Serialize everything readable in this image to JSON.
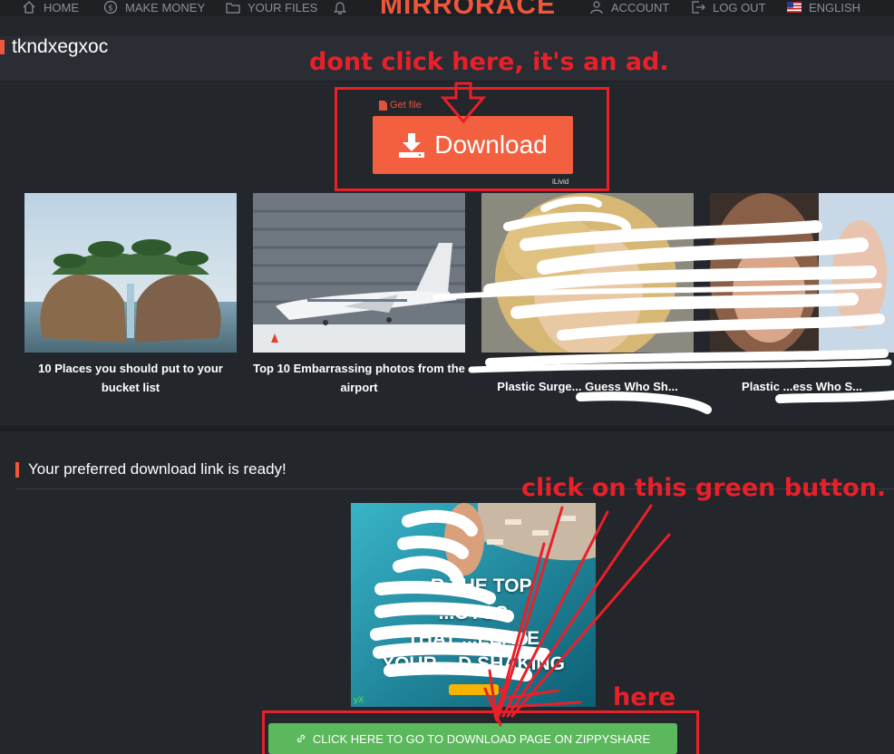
{
  "nav": {
    "items": [
      {
        "label": "HOME",
        "icon": "home-icon"
      },
      {
        "label": "MAKE MONEY",
        "icon": "dollar-icon"
      },
      {
        "label": "YOUR FILES",
        "icon": "folder-icon"
      },
      {
        "label": "",
        "icon": "bell-icon"
      },
      {
        "label": "ACCOUNT",
        "icon": "user-icon"
      },
      {
        "label": "LOG OUT",
        "icon": "logout-icon"
      },
      {
        "label": "ENGLISH",
        "icon": "us-flag-icon"
      }
    ],
    "logo": "MIRRORACE"
  },
  "file": {
    "title": "tkndxegxoc"
  },
  "ad": {
    "get_file": "Get file",
    "download_label": "Download",
    "sponsor": "iLivid"
  },
  "thumbnails": [
    {
      "caption": "10 Places you should put to your bucket list"
    },
    {
      "caption": "Top 10 Embarrassing photos from the airport"
    },
    {
      "caption": "Plastic Surge... Guess Who Sh..."
    },
    {
      "caption": "Plastic ...ess Who S..."
    }
  ],
  "download": {
    "ready_text": "Your preferred download link is ready!",
    "promo_lines": [
      "...R THE TOP",
      "...OTOS",
      "THAT ...LEAVE",
      "YOUR ...D SHAKING"
    ],
    "promo_brand": "yX",
    "zippy_button": "CLICK HERE TO GO TO DOWNLOAD PAGE ON ZIPPYSHARE"
  },
  "annotations": {
    "ad_warning": "dont click here, it's an ad.",
    "green_hint": "click on this green button.",
    "here": "here"
  },
  "colors": {
    "accent": "#f0563a",
    "ad_button": "#f2603f",
    "green_button": "#5cb85c",
    "annotation_red": "#e8202a",
    "background": "#23262b"
  }
}
